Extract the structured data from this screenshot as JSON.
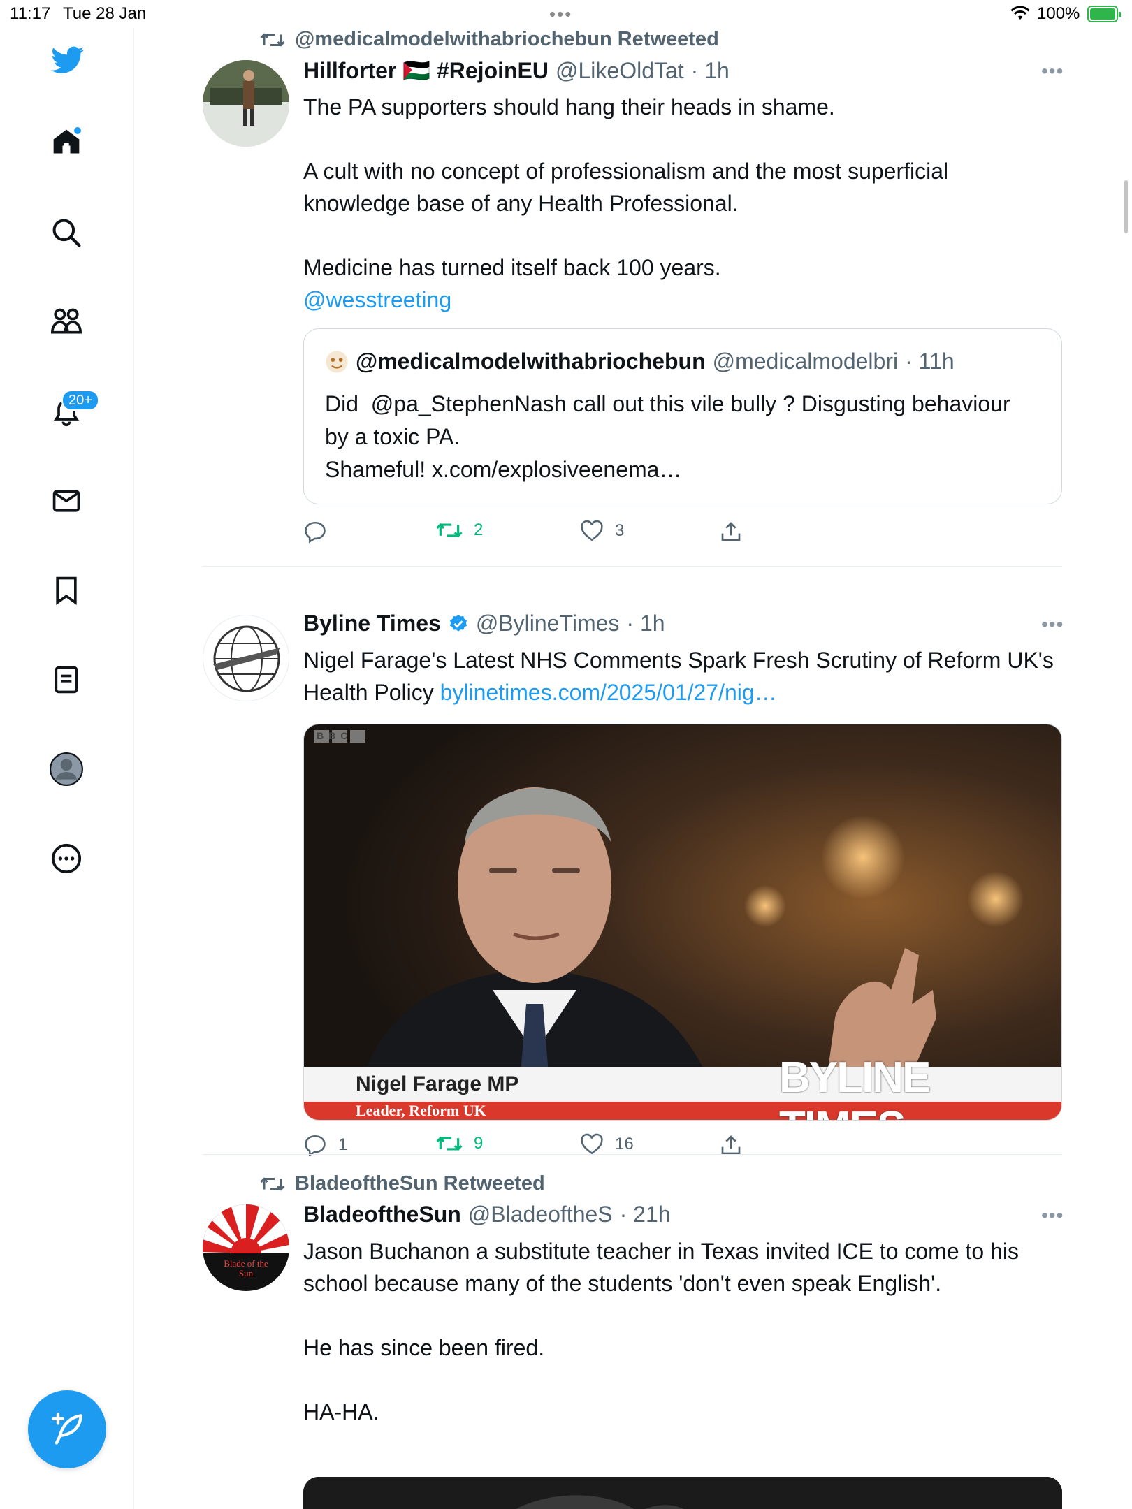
{
  "status_bar": {
    "time": "11:17",
    "date": "Tue 28 Jan",
    "battery": "100%"
  },
  "sidebar": {
    "notifications_badge": "20+",
    "items": [
      "home-icon",
      "search-icon",
      "communities-icon",
      "notifications-icon",
      "messages-icon",
      "bookmarks-icon",
      "lists-icon",
      "profile-icon",
      "more-icon"
    ]
  },
  "colors": {
    "accent": "#1d9bf0",
    "retweet": "#00ba7c",
    "muted": "#536471"
  },
  "tweets": [
    {
      "retweeted_by": "@medicalmodelwithabriochebun Retweeted",
      "name": "Hillforter 🇵🇸 #RejoinEU",
      "handle": "@LikeOldTat",
      "time": "· 1h",
      "text": "The PA supporters should hang their heads in shame.\n\nA cult with no concept of professionalism and the most superficial knowledge base of any Health Professional.\n\nMedicine has turned itself back 100 years.",
      "mention": "@wesstreeting",
      "quote": {
        "name": "@medicalmodelwithabriochebun",
        "handle": "@medicalmodelbri",
        "time": "· 11h",
        "text": "Did  @pa_StephenNash call out this vile bully ? Disgusting behaviour by a toxic PA.\nShameful! x.com/explosiveenema…"
      },
      "replies": "",
      "retweets": "2",
      "likes": "3"
    },
    {
      "name": "Byline Times",
      "handle": "@BylineTimes",
      "time": "· 1h",
      "text": "Nigel Farage's Latest NHS Comments Spark Fresh Scrutiny of Reform UK's Health Policy ",
      "link": "bylinetimes.com/2025/01/27/nig…",
      "image": {
        "broadcaster": "BBC",
        "caption_name": "Nigel Farage MP",
        "caption_role": "Leader, Reform UK",
        "watermark": "BYLINE TIMES"
      },
      "replies": "1",
      "retweets": "9",
      "likes": "16"
    },
    {
      "retweeted_by": "BladeoftheSun Retweeted",
      "name": "BladeoftheSun",
      "handle": "@BladeoftheS",
      "time": "· 21h",
      "text": "Jason Buchanon a substitute teacher in Texas invited ICE to come to his school because many of the students 'don't even speak English'.\n\nHe has since been fired.\n\nHA-HA.",
      "avatar_text": "Blade of the Sun"
    }
  ]
}
